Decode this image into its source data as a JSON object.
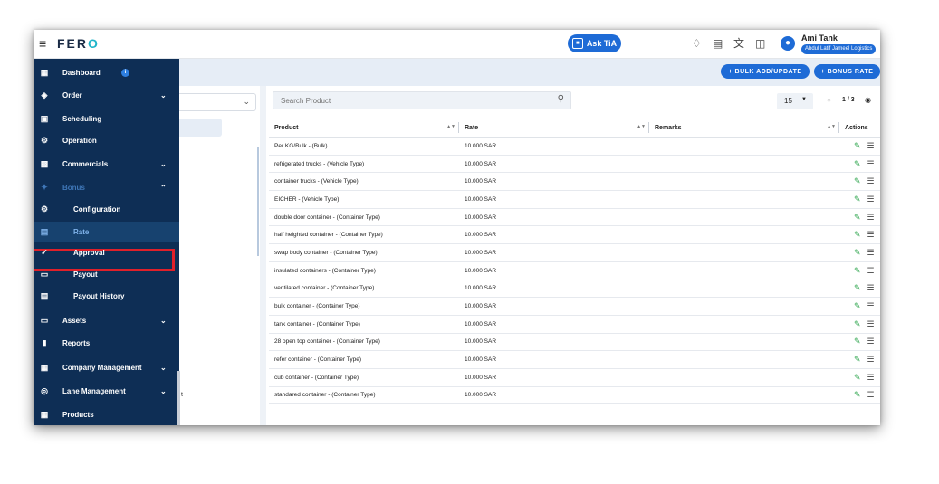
{
  "app": {
    "logo_prefix": "FER",
    "logo_suffix": "O"
  },
  "topbar": {
    "ask_label": "Ask TiA",
    "user_name": "Ami Tank",
    "company": "Abdul Latif Jameel Logistics"
  },
  "sidebar": {
    "items": [
      {
        "label": "Dashboard",
        "icon": "dashboard-icon"
      },
      {
        "label": "Order",
        "icon": "order-icon"
      },
      {
        "label": "Scheduling",
        "icon": "scheduling-icon"
      },
      {
        "label": "Operation",
        "icon": "operation-icon"
      },
      {
        "label": "Commercials",
        "icon": "commercials-icon"
      },
      {
        "label": "Bonus",
        "icon": "bonus-icon"
      },
      {
        "label": "Configuration",
        "icon": "configuration-icon"
      },
      {
        "label": "Rate",
        "icon": "rate-icon"
      },
      {
        "label": "Approval",
        "icon": "approval-icon"
      },
      {
        "label": "Payout",
        "icon": "payout-icon"
      },
      {
        "label": "Payout History",
        "icon": "payout-history-icon"
      },
      {
        "label": "Assets",
        "icon": "assets-icon"
      },
      {
        "label": "Reports",
        "icon": "reports-icon"
      },
      {
        "label": "Company Management",
        "icon": "company-icon"
      },
      {
        "label": "Lane Management",
        "icon": "lane-icon"
      },
      {
        "label": "Products",
        "icon": "products-icon"
      }
    ]
  },
  "toolbar": {
    "bulk_label": "+ BULK ADD/UPDATE",
    "bonus_label": "+ BONUS RATE"
  },
  "search": {
    "placeholder": "Search Product"
  },
  "pagination": {
    "page_size": "15",
    "indicator": "1 / 3"
  },
  "table": {
    "headers": {
      "product": "Product",
      "rate": "Rate",
      "remarks": "Remarks",
      "actions": "Actions"
    },
    "rows": [
      {
        "product": "Per KG/Bulk - (Bulk)",
        "rate": "10.000 SAR"
      },
      {
        "product": "refrigerated trucks - (Vehicle Type)",
        "rate": "10.000 SAR"
      },
      {
        "product": "container trucks - (Vehicle Type)",
        "rate": "10.000 SAR"
      },
      {
        "product": "EICHER - (Vehicle Type)",
        "rate": "10.000 SAR"
      },
      {
        "product": "double door container - (Container Type)",
        "rate": "10.000 SAR"
      },
      {
        "product": "half heighted container - (Container Type)",
        "rate": "10.000 SAR"
      },
      {
        "product": "swap body container - (Container Type)",
        "rate": "10.000 SAR"
      },
      {
        "product": "insulated containers - (Container Type)",
        "rate": "10.000 SAR"
      },
      {
        "product": "ventilated container - (Container Type)",
        "rate": "10.000 SAR"
      },
      {
        "product": "bulk container - (Container Type)",
        "rate": "10.000 SAR"
      },
      {
        "product": "tank container - (Container Type)",
        "rate": "10.000 SAR"
      },
      {
        "product": "28 open top container - (Container Type)",
        "rate": "10.000 SAR"
      },
      {
        "product": "refer container - (Container Type)",
        "rate": "10.000 SAR"
      },
      {
        "product": "cub container - (Container Type)",
        "rate": "10.000 SAR"
      },
      {
        "product": "standared container - (Container Type)",
        "rate": "10.000 SAR"
      }
    ]
  },
  "colors": {
    "primary": "#1e6bd6",
    "sidebar": "#0e2e55",
    "highlight": "#e0202a",
    "edit": "#2aa34a"
  }
}
